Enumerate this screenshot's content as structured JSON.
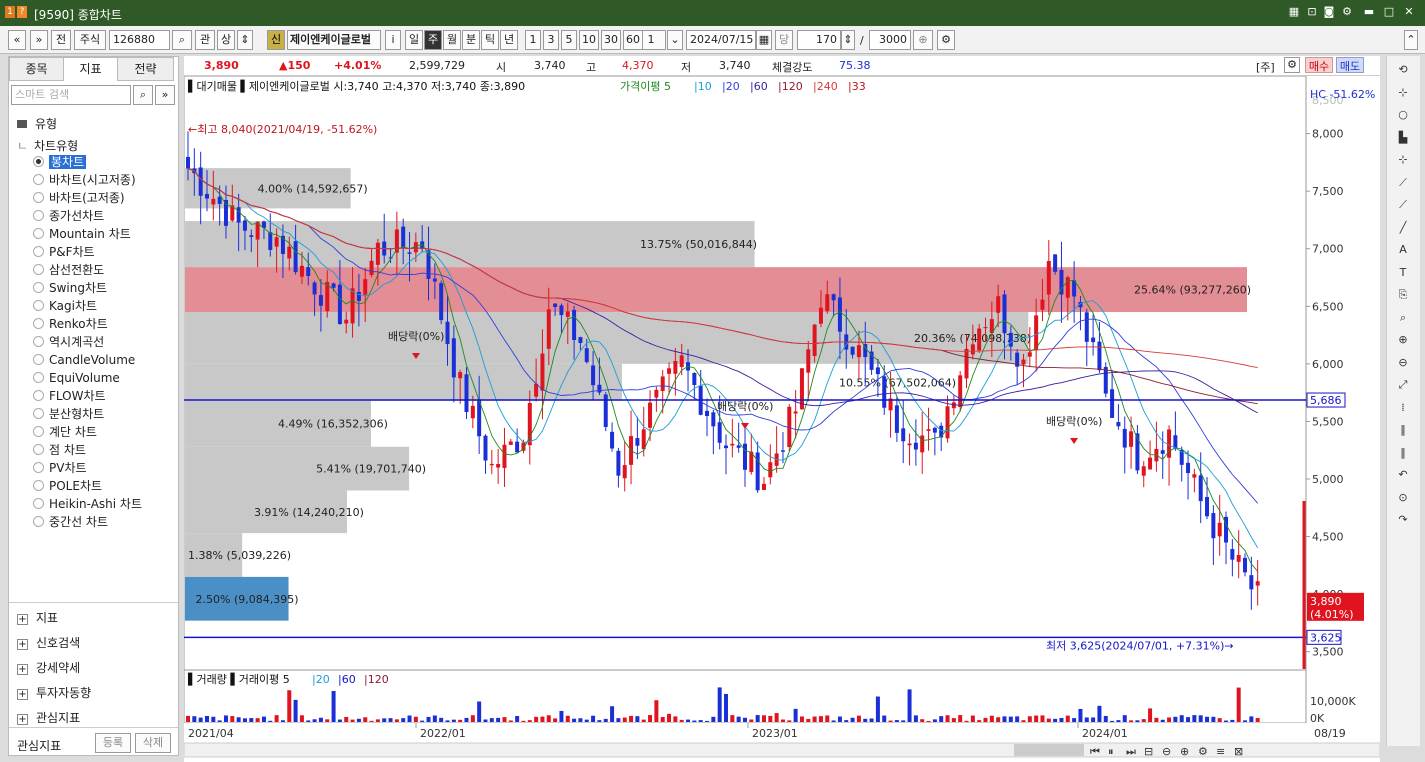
{
  "window": {
    "title": "[9590] 종합차트",
    "logo": "1 ?"
  },
  "toolbar": {
    "prev": "«",
    "down": "»",
    "prev_label": "전",
    "market": "주식",
    "code": "126880",
    "search_icon": "search-icon",
    "rel": "관",
    "up": "상",
    "new_badge": "신",
    "stock_name": "제이엔케이글로벌",
    "info": "i",
    "periods": [
      "일",
      "주",
      "월",
      "분",
      "틱",
      "년"
    ],
    "active_period": "주",
    "nums": [
      "1",
      "3",
      "5",
      "10",
      "30",
      "60"
    ],
    "num_select": "1",
    "date": "2024/07/15",
    "unit": "당",
    "count": "170",
    "slash": "/",
    "total": "3000"
  },
  "left": {
    "tabs": [
      "종목",
      "지표",
      "전략"
    ],
    "active_tab": "지표",
    "search_placeholder": "스마트 검색",
    "group": "유형",
    "subgroup": "차트유형",
    "items": [
      "봉차트",
      "바차트(시고저종)",
      "바차트(고저종)",
      "종가선차트",
      "Mountain 차트",
      "P&F차트",
      "삼선전환도",
      "Swing차트",
      "Kagi차트",
      "Renko차트",
      "역시계곡선",
      "CandleVolume",
      "EquiVolume",
      "FLOW차트",
      "분산형차트",
      "계단 차트",
      "점 차트",
      "PV차트",
      "POLE차트",
      "Heikin-Ashi 차트",
      "중간선 차트"
    ],
    "selected": "봉차트",
    "sections": [
      "지표",
      "신호검색",
      "강세약세",
      "투자자동향",
      "관심지표"
    ],
    "footer_label": "관심지표",
    "register": "등록",
    "delete": "삭제"
  },
  "quote": {
    "price": "3,890",
    "change": "▲150",
    "rate": "+4.01%",
    "volume": "2,599,729",
    "open_label": "시",
    "open": "3,740",
    "high_label": "고",
    "high": "4,370",
    "low_label": "저",
    "low": "3,740",
    "strength_label": "체결강도",
    "strength": "75.38",
    "main_btn": "[주]",
    "buy": "매수",
    "sell": "매도"
  },
  "chart": {
    "legend_price": "▌대기매물 ▌제이엔케이글로벌 시:3,740 고:4,370 저:3,740 종:3,890",
    "legend_ma_label": "가격이평 5",
    "legend_ma": [
      "10",
      "20",
      "60",
      "120",
      "240",
      "33"
    ],
    "hc_label": "HC -51.62%",
    "y_ticks": [
      "8,000",
      "7,500",
      "7,000",
      "6,500",
      "6,000",
      "5,500",
      "5,000",
      "4,500",
      "4,000",
      "3,500"
    ],
    "y_top": "8,500",
    "x_ticks": [
      "2021/04",
      "2022/01",
      "2023/01",
      "2024/01",
      "08/19"
    ],
    "high_note": "←최고 8,040(2021/04/19, -51.62%)",
    "low_note": "최저 3,625(2024/07/01, +7.31%)→",
    "level_line": "5,686",
    "low_line": "3,625",
    "last_price": "3,890",
    "last_rate": "(4.01%)",
    "dividends": [
      "배당락(0%)",
      "배당락(0%)",
      "배당락(0%)"
    ],
    "profile": [
      {
        "label": "4.00% (14,592,657)",
        "pct": 4.0
      },
      {
        "label": "13.75% (50,016,844)",
        "pct": 13.75
      },
      {
        "label": "25.64% (93,277,260)",
        "pct": 25.64
      },
      {
        "label": "20.36% (74,098,738)",
        "pct": 20.36
      },
      {
        "label": "10.55% (67,502,064)",
        "pct": 10.55
      },
      {
        "label": "4.49% (16,352,306)",
        "pct": 4.49
      },
      {
        "label": "5.41% (19,701,740)",
        "pct": 5.41
      },
      {
        "label": "3.91% (14,240,210)",
        "pct": 3.91
      },
      {
        "label": "1.38% (5,039,226)",
        "pct": 1.38
      },
      {
        "label": "2.50% (9,084,395)",
        "pct": 2.5
      }
    ],
    "volume_legend": "▌거래량 ▌거래이평 5",
    "volume_ma": [
      "20",
      "60",
      "120"
    ],
    "vol_ticks": [
      "10,000K",
      "0K"
    ]
  },
  "colors": {
    "up": "#e0141e",
    "down": "#1a2fd6",
    "titlebar": "#2f5a27",
    "profile_hi": "#e38d95",
    "profile": "#c8c8c8",
    "profile_low": "#4a8fc6"
  }
}
